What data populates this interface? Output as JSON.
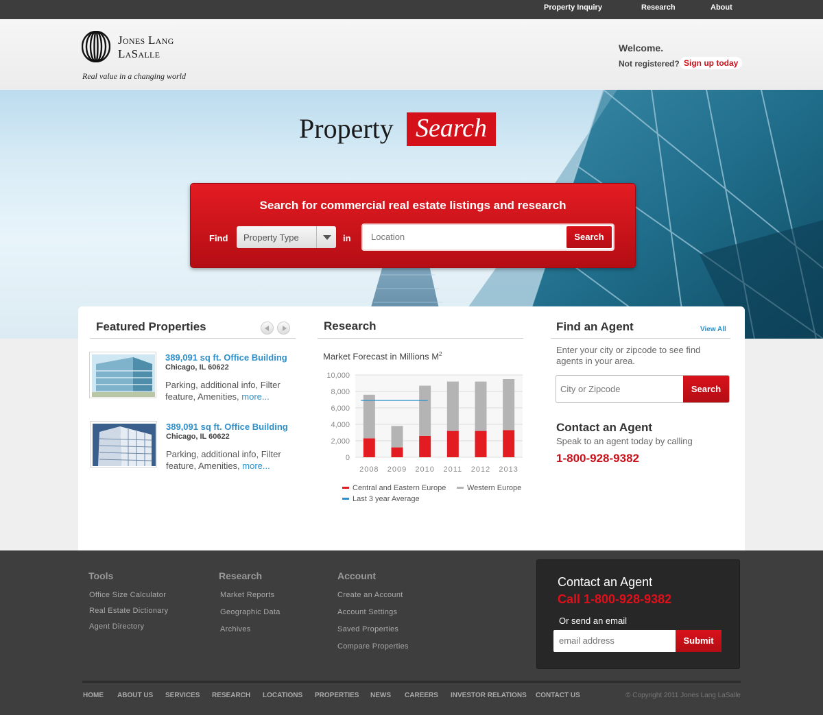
{
  "topnav": {
    "items": [
      "Property Inquiry",
      "Research",
      "About"
    ]
  },
  "header": {
    "brand_line1": "Jones Lang",
    "brand_line2": "LaSalle",
    "tagline": "Real value in a changing world",
    "welcome": "Welcome.",
    "not_registered": "Not registered?",
    "signup": "Sign up today"
  },
  "hero": {
    "title": "Property",
    "title_highlight": "Search",
    "search_heading": "Search for commercial real estate listings and research",
    "find_label": "Find",
    "property_type": "Property Type",
    "in_label": "in",
    "location_placeholder": "Location",
    "search_button": "Search"
  },
  "featured": {
    "heading": "Featured Properties",
    "items": [
      {
        "title": "389,091 sq ft. Office Building",
        "location": "Chicago, IL 60622",
        "desc": "Parking, additional info, Filter feature, Amenities,",
        "more": "more..."
      },
      {
        "title": "389,091 sq ft. Office Building",
        "location": "Chicago, IL 60622",
        "desc": "Parking, additional info, Filter feature, Amenities,",
        "more": "more..."
      }
    ]
  },
  "research": {
    "heading": "Research",
    "chart_title": "Market Forecast in Millions M",
    "chart_title_sup": "2"
  },
  "chart_data": {
    "type": "bar",
    "stacked": true,
    "title": "Market Forecast in Millions M²",
    "categories": [
      "2008",
      "2009",
      "2010",
      "2011",
      "2012",
      "2013"
    ],
    "series": [
      {
        "name": "Central and Eastern Europe",
        "values": [
          2300,
          1200,
          2600,
          3200,
          3200,
          3300
        ],
        "color": "#e31c22"
      },
      {
        "name": "Western Europe",
        "values": [
          5300,
          2600,
          6100,
          6000,
          6000,
          6200
        ],
        "color": "#b4b4b4"
      }
    ],
    "reference_line": {
      "name": "Last 3 year Average",
      "value": 6900,
      "from": "2008",
      "to": "2010",
      "color": "#2f8fc8"
    },
    "y_ticks": [
      "10,000",
      "8,000",
      "6,000",
      "4,000",
      "2,000",
      "0"
    ],
    "ylim": [
      0,
      10000
    ],
    "grid": true,
    "legend": "bottom"
  },
  "agent": {
    "heading": "Find an Agent",
    "view_all": "View All",
    "intro": "Enter your city or zipcode to see find agents in your area.",
    "input_placeholder": "City or Zipcode",
    "search_button": "Search",
    "contact_heading": "Contact an Agent",
    "contact_sub": "Speak to an agent today by calling",
    "phone": "1-800-928-9382"
  },
  "footer": {
    "tools": {
      "heading": "Tools",
      "links": [
        "Office Size Calculator",
        "Real Estate Dictionary",
        "Agent Directory"
      ]
    },
    "research": {
      "heading": "Research",
      "links": [
        "Market Reports",
        "Geographic Data",
        "Archives"
      ]
    },
    "account": {
      "heading": "Account",
      "links": [
        "Create an Account",
        "Account Settings",
        "Saved Properties",
        "Compare Properties"
      ]
    },
    "contact": {
      "heading": "Contact an Agent",
      "call": "Call 1-800-928-9382",
      "or_email": "Or send an email",
      "email_placeholder": "email address",
      "submit": "Submit"
    },
    "nav": [
      "HOME",
      "ABOUT US",
      "SERVICES",
      "RESEARCH",
      "LOCATIONS",
      "PROPERTIES",
      "NEWS",
      "CAREERS",
      "INVESTOR RELATIONS",
      "CONTACT US"
    ],
    "copyright": "© Copyright 2011 Jones Lang LaSalle"
  },
  "colors": {
    "brand_red": "#d4111a",
    "link_blue": "#2f8fc8",
    "footer_bg": "#3e3e3e"
  }
}
